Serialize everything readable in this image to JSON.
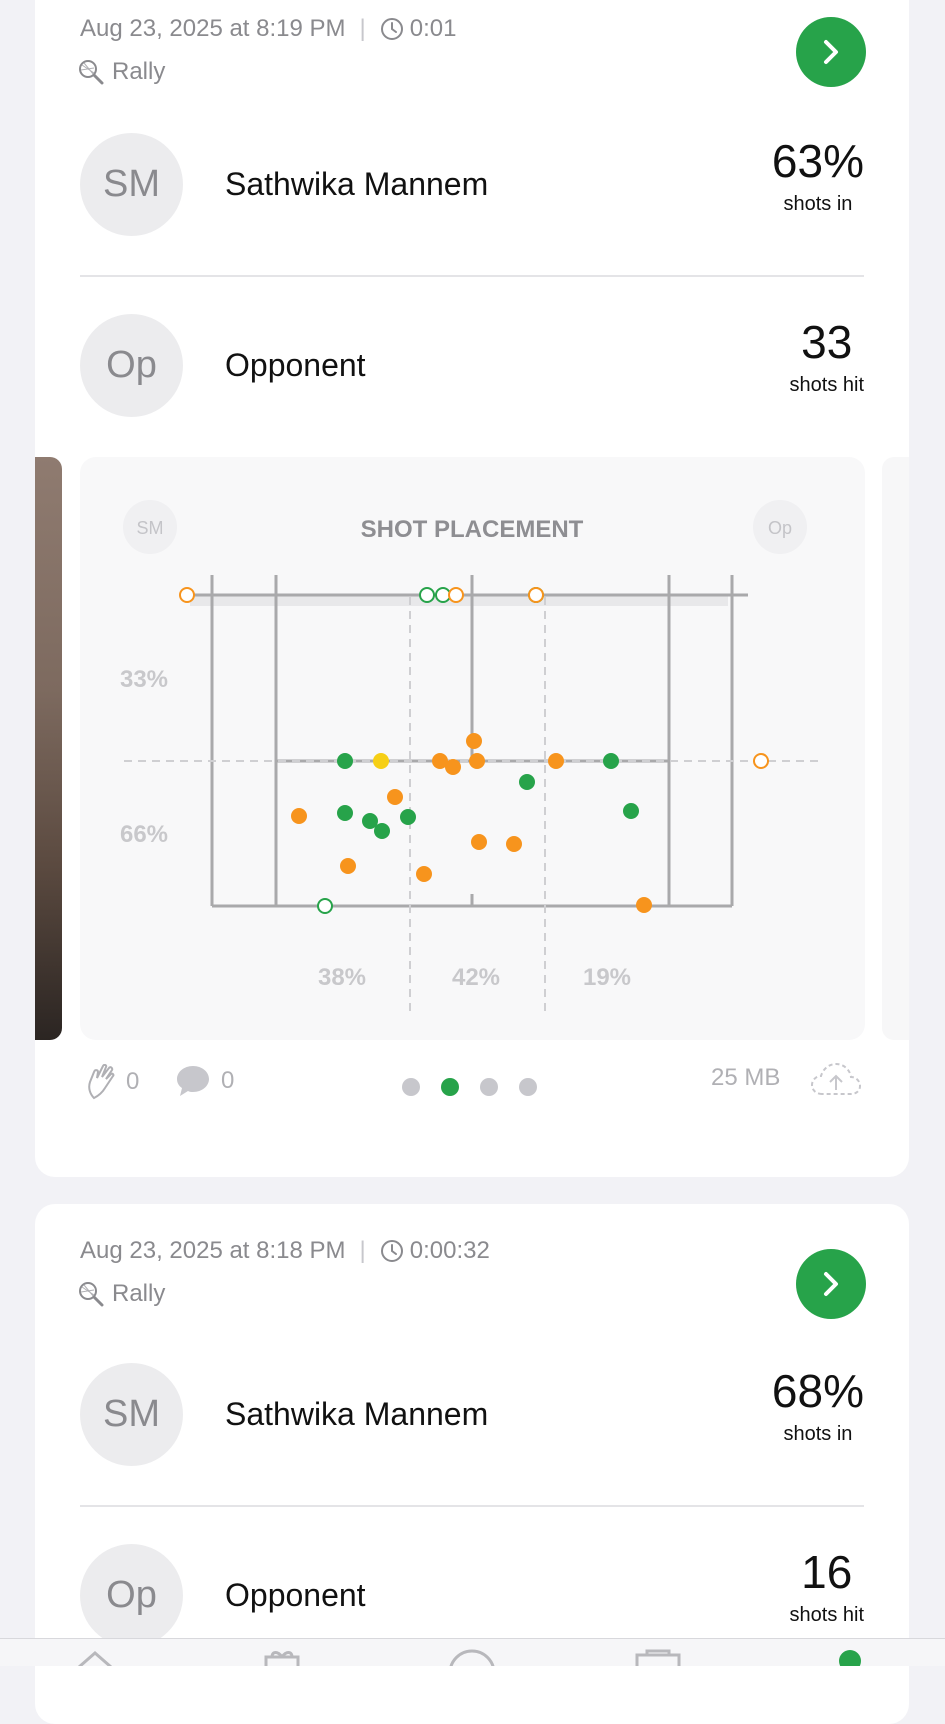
{
  "sessions": [
    {
      "date": "Aug 23, 2025 at 8:19 PM",
      "duration": "0:01",
      "activity": "Rally",
      "player": {
        "initials": "SM",
        "name": "Sathwika Mannem",
        "stat_value": "63%",
        "stat_label": "shots in"
      },
      "opponent": {
        "initials": "Op",
        "name": "Opponent",
        "stat_value": "33",
        "stat_label": "shots hit"
      },
      "likes": "0",
      "comments": "0",
      "file_size": "25 MB",
      "carousel": {
        "count": 4,
        "active_index": 1
      }
    },
    {
      "date": "Aug 23, 2025 at 8:18 PM",
      "duration": "0:00:32",
      "activity": "Rally",
      "player": {
        "initials": "SM",
        "name": "Sathwika Mannem",
        "stat_value": "68%",
        "stat_label": "shots in"
      },
      "opponent": {
        "initials": "Op",
        "name": "Opponent",
        "stat_value": "16",
        "stat_label": "shots hit"
      }
    }
  ],
  "shot_placement": {
    "title": "SHOT PLACEMENT",
    "left_badge": "SM",
    "right_badge": "Op",
    "depth_labels": [
      "33%",
      "66%"
    ],
    "width_labels": [
      "38%",
      "42%",
      "19%"
    ]
  },
  "colors": {
    "accent_green": "#27a34a",
    "orange": "#f7941d",
    "yellow": "#f6cf16",
    "court_line": "#a9a9ab"
  },
  "tabbar": {
    "icons": [
      "home-icon",
      "gift-icon",
      "ball-icon",
      "inbox-icon",
      "profile-status-icon"
    ]
  }
}
